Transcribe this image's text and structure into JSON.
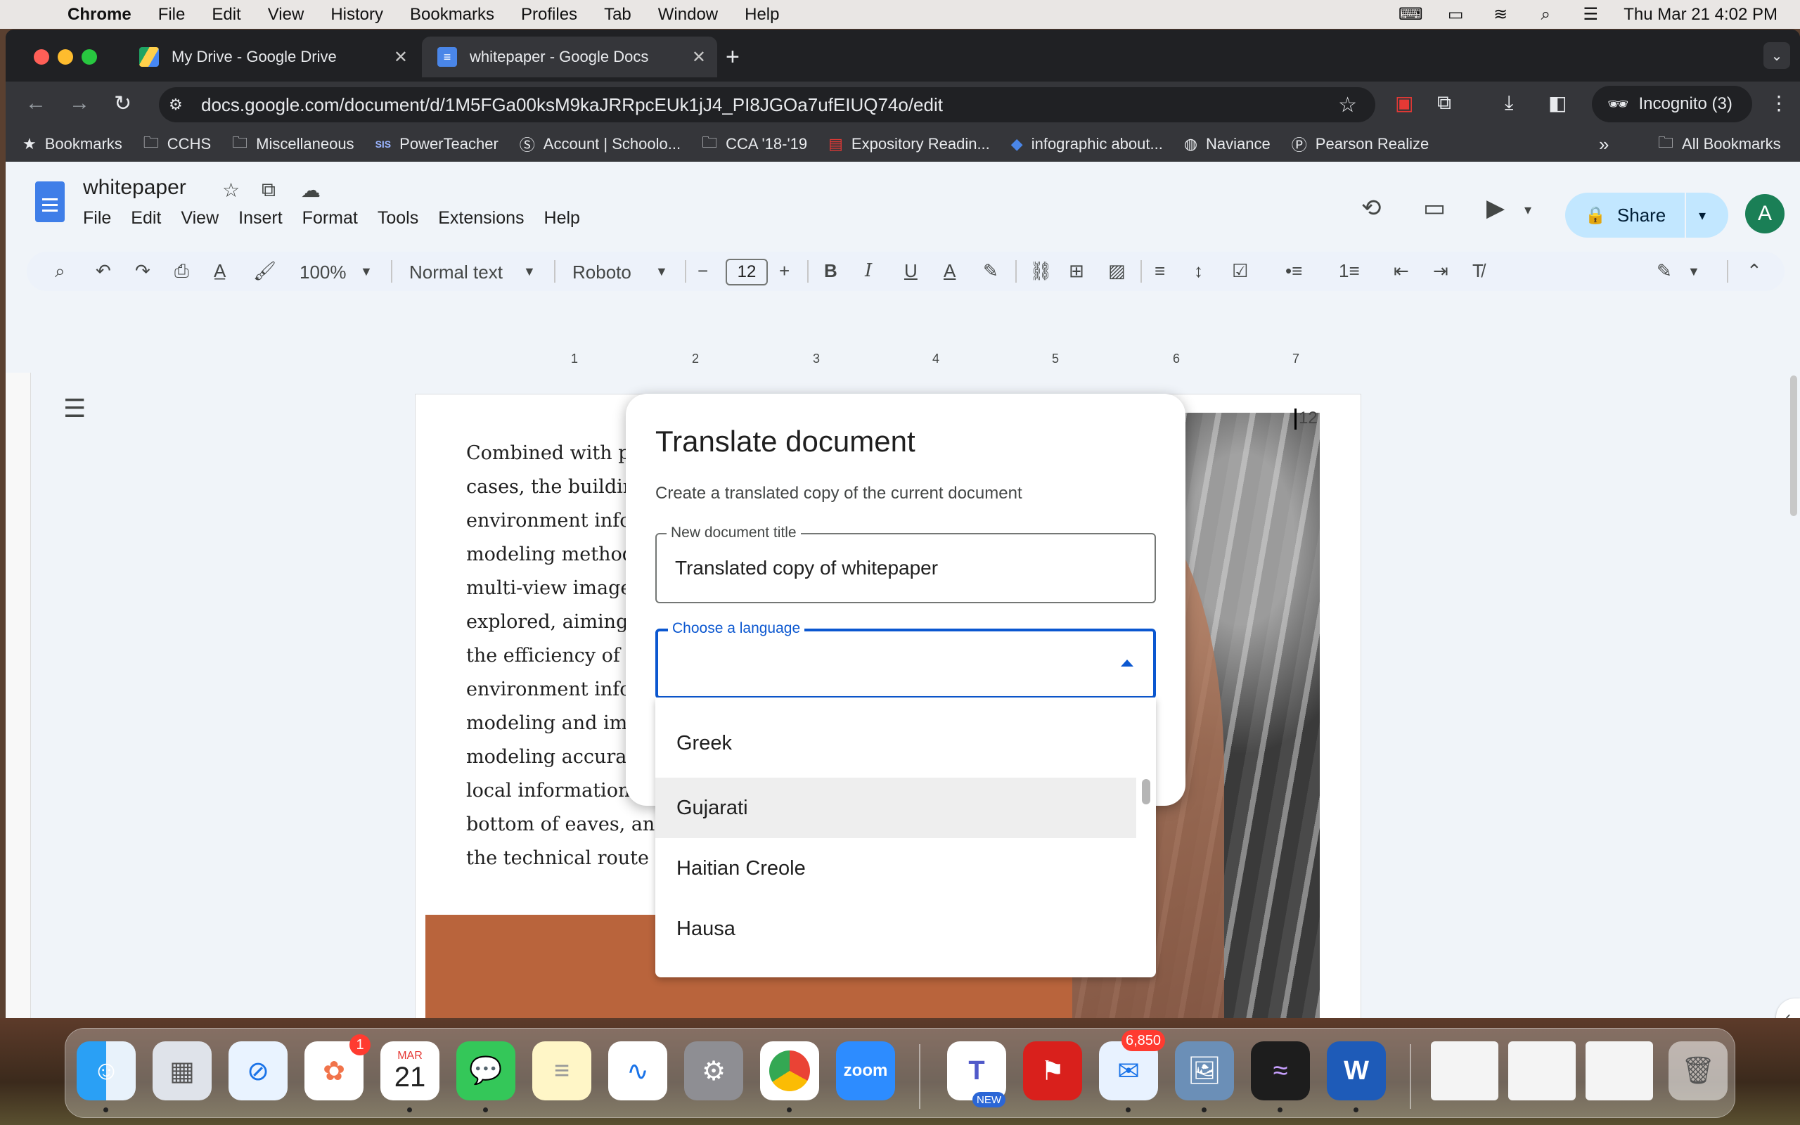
{
  "menubar": {
    "app": "Chrome",
    "items": [
      "File",
      "Edit",
      "View",
      "History",
      "Bookmarks",
      "Profiles",
      "Tab",
      "Window",
      "Help"
    ],
    "clock": "Thu Mar 21  4:02 PM"
  },
  "browser": {
    "tabs": [
      {
        "title": "My Drive - Google Drive",
        "icon": "google-drive-icon"
      },
      {
        "title": "whitepaper - Google Docs",
        "icon": "google-docs-icon",
        "active": true
      }
    ],
    "url": "docs.google.com/document/d/1M5FGa00ksM9kaJRRpcEUk1jJ4_PI8JGOa7ufEIUQ74o/edit",
    "incognito_label": "Incognito (3)",
    "bookmarks": [
      {
        "label": "Bookmarks",
        "icon": "star-icon"
      },
      {
        "label": "CCHS",
        "icon": "folder-icon"
      },
      {
        "label": "Miscellaneous",
        "icon": "folder-icon"
      },
      {
        "label": "PowerTeacher",
        "icon": "sis-icon"
      },
      {
        "label": "Account | Schoolo...",
        "icon": "schoology-icon"
      },
      {
        "label": "CCA '18-'19",
        "icon": "folder-icon"
      },
      {
        "label": "Expository Readin...",
        "icon": "csu-icon"
      },
      {
        "label": "infographic about...",
        "icon": "bookmark-icon"
      },
      {
        "label": "Naviance",
        "icon": "globe-icon"
      },
      {
        "label": "Pearson Realize",
        "icon": "pearson-icon"
      }
    ],
    "all_bookmarks_label": "All Bookmarks"
  },
  "docs": {
    "title": "whitepaper",
    "menu": [
      "File",
      "Edit",
      "View",
      "Insert",
      "Format",
      "Tools",
      "Extensions",
      "Help"
    ],
    "share_label": "Share",
    "avatar_letter": "A",
    "toolbar": {
      "zoom": "100%",
      "style": "Normal text",
      "font": "Roboto",
      "font_size": "12"
    },
    "ruler_ticks": [
      "1",
      "2",
      "3",
      "4",
      "5",
      "6",
      "7"
    ],
    "page_number": "12",
    "body_lines": [
      "Combined with pr",
      "cases, the buildin",
      "environment info",
      "modeling method",
      "multi-view image",
      "explored, aiming",
      "the efficiency of b",
      "environment info",
      "modeling and imp",
      "modeling accurac",
      "local information su",
      "bottom of eaves, and",
      "the technical route o"
    ]
  },
  "dialog": {
    "title": "Translate document",
    "subtitle": "Create a translated copy of the current document",
    "title_field_label": "New document title",
    "title_field_value": "Translated copy of whitepaper",
    "language_field_label": "Choose a language",
    "language_field_value": "",
    "options": [
      "Greek",
      "Gujarati",
      "Haitian Creole",
      "Hausa"
    ],
    "hovered_option": "Gujarati"
  },
  "dock": {
    "calendar_month": "MAR",
    "calendar_day": "21",
    "photos_badge": "1",
    "mail_badge": "6,850",
    "teams_badge": "NEW",
    "zoom_label": "zoom"
  }
}
